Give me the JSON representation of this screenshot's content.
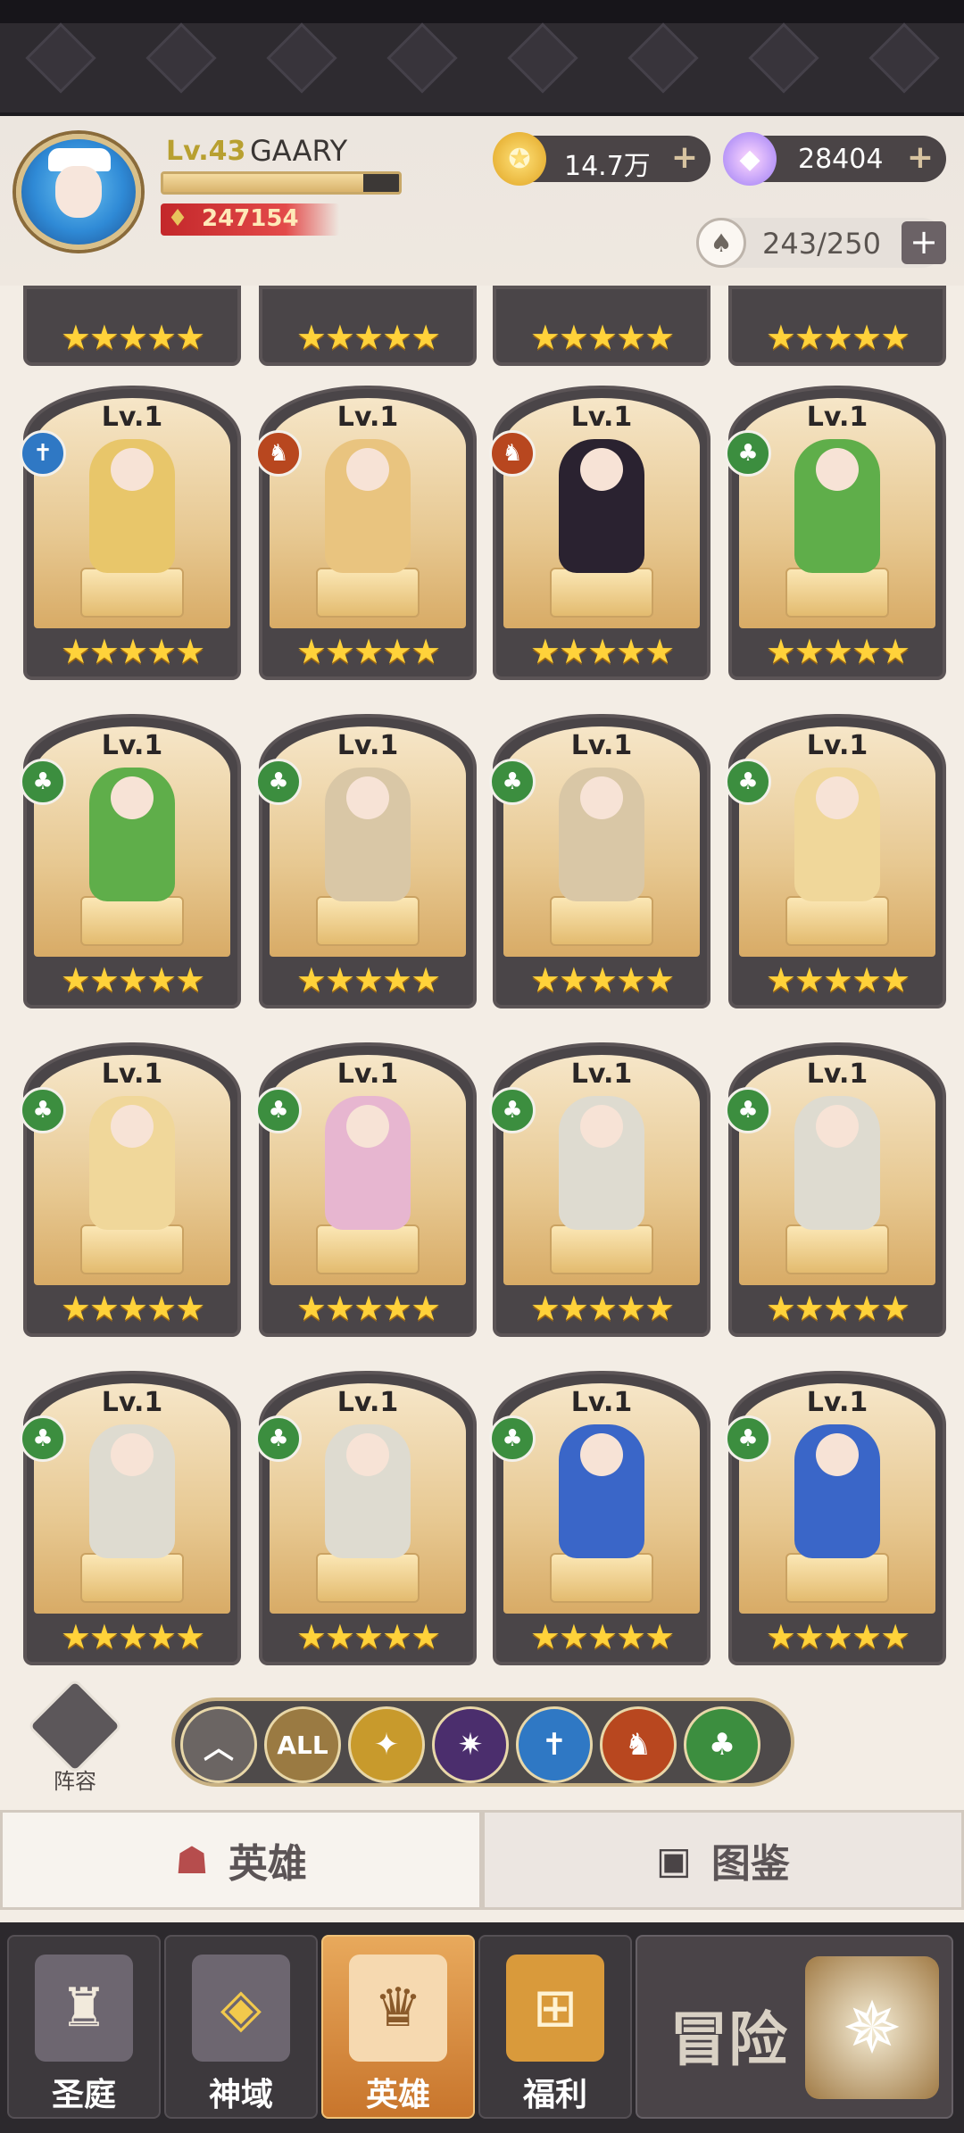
{
  "player": {
    "level": "Lv.43",
    "name": "GAARY",
    "exp_fraction": 0.85,
    "power": "247154"
  },
  "currency": {
    "gold": "14.7万",
    "diamonds": "28404",
    "hero_capacity": "243/250"
  },
  "heroes": [
    {
      "level": "Lv.1",
      "faction": "holy",
      "stars": "★★★★★"
    },
    {
      "level": "Lv.1",
      "faction": "beast",
      "stars": "★★★★★"
    },
    {
      "level": "Lv.1",
      "faction": "beast",
      "stars": "★★★★★"
    },
    {
      "level": "Lv.1",
      "faction": "nature",
      "stars": "★★★★★"
    },
    {
      "level": "Lv.1",
      "faction": "nature",
      "stars": "★★★★★"
    },
    {
      "level": "Lv.1",
      "faction": "nature",
      "stars": "★★★★★"
    },
    {
      "level": "Lv.1",
      "faction": "nature",
      "stars": "★★★★★"
    },
    {
      "level": "Lv.1",
      "faction": "nature",
      "stars": "★★★★★"
    },
    {
      "level": "Lv.1",
      "faction": "nature",
      "stars": "★★★★★"
    },
    {
      "level": "Lv.1",
      "faction": "nature",
      "stars": "★★★★★"
    },
    {
      "level": "Lv.1",
      "faction": "nature",
      "stars": "★★★★★"
    },
    {
      "level": "Lv.1",
      "faction": "nature",
      "stars": "★★★★★"
    },
    {
      "level": "Lv.1",
      "faction": "nature",
      "stars": "★★★★★"
    },
    {
      "level": "Lv.1",
      "faction": "nature",
      "stars": "★★★★★"
    },
    {
      "level": "Lv.1",
      "faction": "nature",
      "stars": "★★★★★"
    },
    {
      "level": "Lv.1",
      "faction": "nature",
      "stars": "★★★★★"
    }
  ],
  "partial_row_stars": "★★★★★",
  "formation_label": "阵容",
  "filters": {
    "all_label": "ALL"
  },
  "tabs": {
    "heroes": "英雄",
    "codex": "图鉴"
  },
  "nav": {
    "courtyard": "圣庭",
    "divine": "神域",
    "heroes": "英雄",
    "welfare": "福利",
    "adventure": "冒险"
  },
  "colors": {
    "nature": "#3c8e3f",
    "holy": "#2f78c4",
    "beast": "#b8471f",
    "star": "#ffd23a"
  }
}
